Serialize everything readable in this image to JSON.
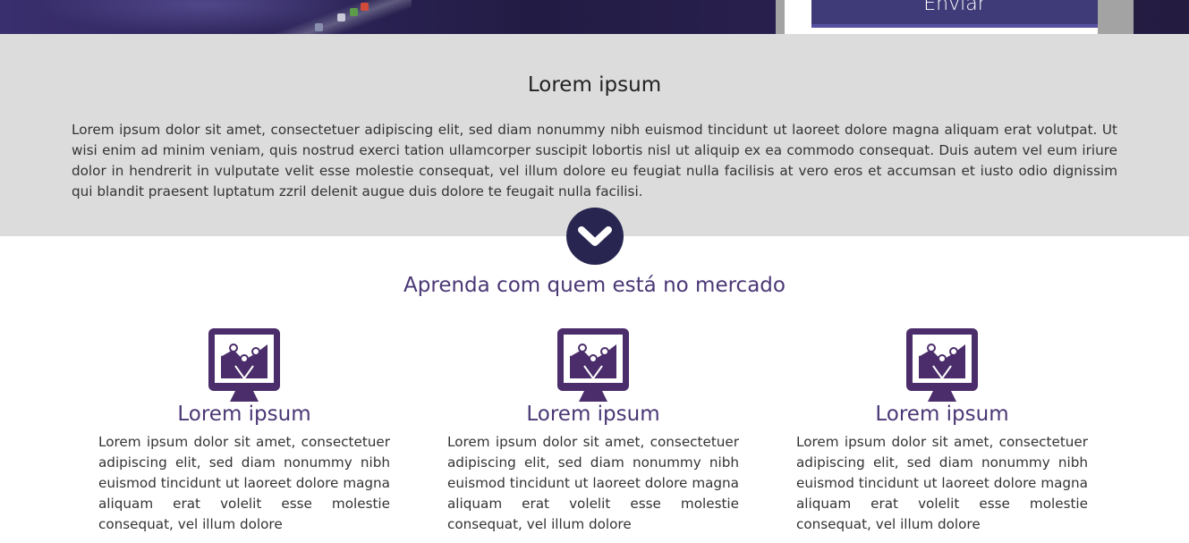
{
  "header": {
    "send_label": "Enviar"
  },
  "intro": {
    "title": "Lorem ipsum",
    "text": "Lorem ipsum dolor sit amet, consectetuer adipiscing elit, sed diam nonummy nibh euismod tincidunt ut laoreet dolore magna aliquam erat volutpat. Ut wisi enim ad minim veniam, quis nostrud exerci tation ullamcorper suscipit lobortis nisl ut aliquip ex ea commodo consequat. Duis autem vel eum iriure dolor in hendrerit in vulputate velit esse molestie consequat, vel illum dolore eu feugiat nulla facilisis at vero eros et accumsan et iusto odio dignissim qui blandit praesent luptatum zzril delenit augue duis dolore te feugait nulla facilisi."
  },
  "scroll_icon": "chevron-down-icon",
  "section": {
    "title": "Aprenda com quem está no mercado"
  },
  "features": [
    {
      "icon": "monitor-chart-icon",
      "title": "Lorem ipsum",
      "text": "Lorem ipsum dolor sit amet, consectetuer adipiscing elit, sed diam nonummy nibh euismod tincidunt ut laoreet dolore magna aliquam erat volelit esse molestie consequat, vel illum dolore"
    },
    {
      "icon": "monitor-chart-icon",
      "title": "Lorem ipsum",
      "text": "Lorem ipsum dolor sit amet, consectetuer adipiscing elit, sed diam nonummy nibh euismod tincidunt ut laoreet dolore magna aliquam erat volelit esse molestie consequat, vel illum dolore"
    },
    {
      "icon": "monitor-chart-icon",
      "title": "Lorem ipsum",
      "text": "Lorem ipsum dolor sit amet, consectetuer adipiscing elit, sed diam nonummy nibh euismod tincidunt ut laoreet dolore magna aliquam erat volelit esse molestie consequat, vel illum dolore"
    }
  ],
  "colors": {
    "accent": "#4a3775",
    "button": "#3f3a78",
    "intro_bg": "#dcdcdc",
    "circle": "#282650"
  }
}
